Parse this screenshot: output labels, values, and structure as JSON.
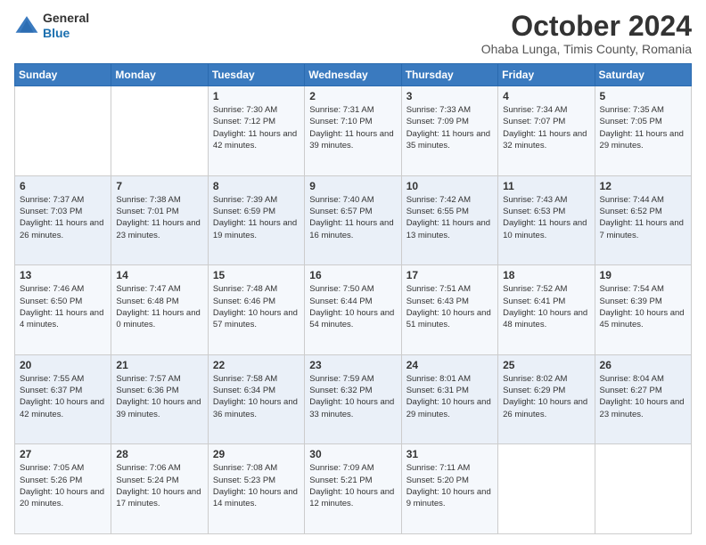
{
  "logo": {
    "general": "General",
    "blue": "Blue"
  },
  "header": {
    "title": "October 2024",
    "subtitle": "Ohaba Lunga, Timis County, Romania"
  },
  "weekdays": [
    "Sunday",
    "Monday",
    "Tuesday",
    "Wednesday",
    "Thursday",
    "Friday",
    "Saturday"
  ],
  "weeks": [
    [
      {
        "day": "",
        "sunrise": "",
        "sunset": "",
        "daylight": ""
      },
      {
        "day": "",
        "sunrise": "",
        "sunset": "",
        "daylight": ""
      },
      {
        "day": "1",
        "sunrise": "Sunrise: 7:30 AM",
        "sunset": "Sunset: 7:12 PM",
        "daylight": "Daylight: 11 hours and 42 minutes."
      },
      {
        "day": "2",
        "sunrise": "Sunrise: 7:31 AM",
        "sunset": "Sunset: 7:10 PM",
        "daylight": "Daylight: 11 hours and 39 minutes."
      },
      {
        "day": "3",
        "sunrise": "Sunrise: 7:33 AM",
        "sunset": "Sunset: 7:09 PM",
        "daylight": "Daylight: 11 hours and 35 minutes."
      },
      {
        "day": "4",
        "sunrise": "Sunrise: 7:34 AM",
        "sunset": "Sunset: 7:07 PM",
        "daylight": "Daylight: 11 hours and 32 minutes."
      },
      {
        "day": "5",
        "sunrise": "Sunrise: 7:35 AM",
        "sunset": "Sunset: 7:05 PM",
        "daylight": "Daylight: 11 hours and 29 minutes."
      }
    ],
    [
      {
        "day": "6",
        "sunrise": "Sunrise: 7:37 AM",
        "sunset": "Sunset: 7:03 PM",
        "daylight": "Daylight: 11 hours and 26 minutes."
      },
      {
        "day": "7",
        "sunrise": "Sunrise: 7:38 AM",
        "sunset": "Sunset: 7:01 PM",
        "daylight": "Daylight: 11 hours and 23 minutes."
      },
      {
        "day": "8",
        "sunrise": "Sunrise: 7:39 AM",
        "sunset": "Sunset: 6:59 PM",
        "daylight": "Daylight: 11 hours and 19 minutes."
      },
      {
        "day": "9",
        "sunrise": "Sunrise: 7:40 AM",
        "sunset": "Sunset: 6:57 PM",
        "daylight": "Daylight: 11 hours and 16 minutes."
      },
      {
        "day": "10",
        "sunrise": "Sunrise: 7:42 AM",
        "sunset": "Sunset: 6:55 PM",
        "daylight": "Daylight: 11 hours and 13 minutes."
      },
      {
        "day": "11",
        "sunrise": "Sunrise: 7:43 AM",
        "sunset": "Sunset: 6:53 PM",
        "daylight": "Daylight: 11 hours and 10 minutes."
      },
      {
        "day": "12",
        "sunrise": "Sunrise: 7:44 AM",
        "sunset": "Sunset: 6:52 PM",
        "daylight": "Daylight: 11 hours and 7 minutes."
      }
    ],
    [
      {
        "day": "13",
        "sunrise": "Sunrise: 7:46 AM",
        "sunset": "Sunset: 6:50 PM",
        "daylight": "Daylight: 11 hours and 4 minutes."
      },
      {
        "day": "14",
        "sunrise": "Sunrise: 7:47 AM",
        "sunset": "Sunset: 6:48 PM",
        "daylight": "Daylight: 11 hours and 0 minutes."
      },
      {
        "day": "15",
        "sunrise": "Sunrise: 7:48 AM",
        "sunset": "Sunset: 6:46 PM",
        "daylight": "Daylight: 10 hours and 57 minutes."
      },
      {
        "day": "16",
        "sunrise": "Sunrise: 7:50 AM",
        "sunset": "Sunset: 6:44 PM",
        "daylight": "Daylight: 10 hours and 54 minutes."
      },
      {
        "day": "17",
        "sunrise": "Sunrise: 7:51 AM",
        "sunset": "Sunset: 6:43 PM",
        "daylight": "Daylight: 10 hours and 51 minutes."
      },
      {
        "day": "18",
        "sunrise": "Sunrise: 7:52 AM",
        "sunset": "Sunset: 6:41 PM",
        "daylight": "Daylight: 10 hours and 48 minutes."
      },
      {
        "day": "19",
        "sunrise": "Sunrise: 7:54 AM",
        "sunset": "Sunset: 6:39 PM",
        "daylight": "Daylight: 10 hours and 45 minutes."
      }
    ],
    [
      {
        "day": "20",
        "sunrise": "Sunrise: 7:55 AM",
        "sunset": "Sunset: 6:37 PM",
        "daylight": "Daylight: 10 hours and 42 minutes."
      },
      {
        "day": "21",
        "sunrise": "Sunrise: 7:57 AM",
        "sunset": "Sunset: 6:36 PM",
        "daylight": "Daylight: 10 hours and 39 minutes."
      },
      {
        "day": "22",
        "sunrise": "Sunrise: 7:58 AM",
        "sunset": "Sunset: 6:34 PM",
        "daylight": "Daylight: 10 hours and 36 minutes."
      },
      {
        "day": "23",
        "sunrise": "Sunrise: 7:59 AM",
        "sunset": "Sunset: 6:32 PM",
        "daylight": "Daylight: 10 hours and 33 minutes."
      },
      {
        "day": "24",
        "sunrise": "Sunrise: 8:01 AM",
        "sunset": "Sunset: 6:31 PM",
        "daylight": "Daylight: 10 hours and 29 minutes."
      },
      {
        "day": "25",
        "sunrise": "Sunrise: 8:02 AM",
        "sunset": "Sunset: 6:29 PM",
        "daylight": "Daylight: 10 hours and 26 minutes."
      },
      {
        "day": "26",
        "sunrise": "Sunrise: 8:04 AM",
        "sunset": "Sunset: 6:27 PM",
        "daylight": "Daylight: 10 hours and 23 minutes."
      }
    ],
    [
      {
        "day": "27",
        "sunrise": "Sunrise: 7:05 AM",
        "sunset": "Sunset: 5:26 PM",
        "daylight": "Daylight: 10 hours and 20 minutes."
      },
      {
        "day": "28",
        "sunrise": "Sunrise: 7:06 AM",
        "sunset": "Sunset: 5:24 PM",
        "daylight": "Daylight: 10 hours and 17 minutes."
      },
      {
        "day": "29",
        "sunrise": "Sunrise: 7:08 AM",
        "sunset": "Sunset: 5:23 PM",
        "daylight": "Daylight: 10 hours and 14 minutes."
      },
      {
        "day": "30",
        "sunrise": "Sunrise: 7:09 AM",
        "sunset": "Sunset: 5:21 PM",
        "daylight": "Daylight: 10 hours and 12 minutes."
      },
      {
        "day": "31",
        "sunrise": "Sunrise: 7:11 AM",
        "sunset": "Sunset: 5:20 PM",
        "daylight": "Daylight: 10 hours and 9 minutes."
      },
      {
        "day": "",
        "sunrise": "",
        "sunset": "",
        "daylight": ""
      },
      {
        "day": "",
        "sunrise": "",
        "sunset": "",
        "daylight": ""
      }
    ]
  ]
}
